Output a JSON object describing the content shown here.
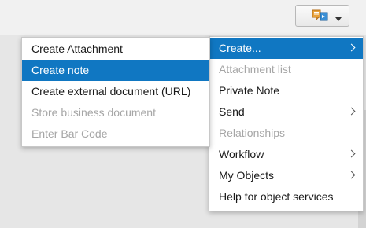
{
  "toolbar": {
    "gos_button_icon": "services-for-object-icon",
    "dropdown_icon": "dropdown-arrow-icon"
  },
  "main_menu": {
    "items": [
      {
        "label": "Create...",
        "state": "selected",
        "submenu": true
      },
      {
        "label": "Attachment list",
        "state": "disabled",
        "submenu": false
      },
      {
        "label": "Private Note",
        "state": "normal",
        "submenu": false
      },
      {
        "label": "Send",
        "state": "normal",
        "submenu": true
      },
      {
        "label": "Relationships",
        "state": "disabled",
        "submenu": false
      },
      {
        "label": "Workflow",
        "state": "normal",
        "submenu": true
      },
      {
        "label": "My Objects",
        "state": "normal",
        "submenu": true
      },
      {
        "label": "Help for object services",
        "state": "normal",
        "submenu": false
      }
    ]
  },
  "sub_menu": {
    "items": [
      {
        "label": "Create Attachment",
        "state": "normal"
      },
      {
        "label": "Create note",
        "state": "selected"
      },
      {
        "label": "Create external document (URL)",
        "state": "normal"
      },
      {
        "label": "Store business document",
        "state": "disabled"
      },
      {
        "label": "Enter Bar Code",
        "state": "disabled"
      }
    ]
  },
  "colors": {
    "selection": "#1077c2",
    "disabled_text": "#a6a6a6"
  }
}
